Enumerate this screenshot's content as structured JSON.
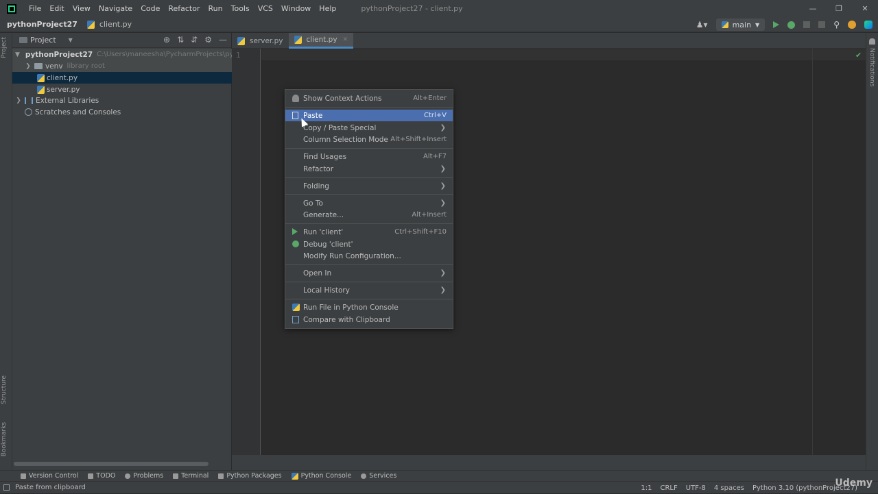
{
  "menubar": {
    "items": [
      "File",
      "Edit",
      "View",
      "Navigate",
      "Code",
      "Refactor",
      "Run",
      "Tools",
      "VCS",
      "Window",
      "Help"
    ],
    "window_title": "pythonProject27 - client.py"
  },
  "navbar": {
    "project": "pythonProject27",
    "file": "client.py",
    "run_config": "main"
  },
  "left_stripe": {
    "project_label": "Project",
    "structure_label": "Structure",
    "bookmarks_label": "Bookmarks"
  },
  "right_stripe": {
    "notifications_label": "Notifications"
  },
  "project_panel": {
    "title": "Project",
    "tree": [
      {
        "label": "pythonProject27",
        "note": "C:\\Users\\maneesha\\PycharmProjects\\pythonP"
      },
      {
        "label": "venv",
        "note": "library root"
      },
      {
        "label": "client.py",
        "note": ""
      },
      {
        "label": "server.py",
        "note": ""
      },
      {
        "label": "External Libraries",
        "note": ""
      },
      {
        "label": "Scratches and Consoles",
        "note": ""
      }
    ]
  },
  "tabs": [
    {
      "label": "server.py",
      "active": false
    },
    {
      "label": "client.py",
      "active": true
    }
  ],
  "editor": {
    "line_number": "1"
  },
  "context_menu": {
    "items": [
      {
        "label": "Show Context Actions",
        "shortcut": "Alt+Enter",
        "icon": "bulb-icon"
      },
      {
        "label": "Paste",
        "shortcut": "Ctrl+V",
        "icon": "clipboard-icon",
        "selected": true
      },
      {
        "label": "Copy / Paste Special",
        "submenu": true
      },
      {
        "label": "Column Selection Mode",
        "shortcut": "Alt+Shift+Insert"
      },
      {
        "label": "Find Usages",
        "shortcut": "Alt+F7"
      },
      {
        "label": "Refactor",
        "submenu": true
      },
      {
        "label": "Folding",
        "submenu": true
      },
      {
        "label": "Go To",
        "submenu": true
      },
      {
        "label": "Generate...",
        "shortcut": "Alt+Insert"
      },
      {
        "label": "Run 'client'",
        "shortcut": "Ctrl+Shift+F10",
        "icon": "run-icon"
      },
      {
        "label": "Debug 'client'",
        "icon": "debug-icon"
      },
      {
        "label": "Modify Run Configuration..."
      },
      {
        "label": "Open In",
        "submenu": true
      },
      {
        "label": "Local History",
        "submenu": true
      },
      {
        "label": "Run File in Python Console",
        "icon": "python-icon"
      },
      {
        "label": "Compare with Clipboard",
        "icon": "compare-icon"
      }
    ]
  },
  "bottom_tools": [
    "Version Control",
    "TODO",
    "Problems",
    "Terminal",
    "Python Packages",
    "Python Console",
    "Services"
  ],
  "status": {
    "message": "Paste from clipboard",
    "position": "1:1",
    "line_sep": "CRLF",
    "encoding": "UTF-8",
    "indent": "4 spaces",
    "interpreter": "Python 3.10 (pythonProject27)"
  },
  "watermark": "Udemy",
  "colors": {
    "selection": "#4b6eaf",
    "run_green": "#59a869",
    "tab_underline": "#4a88c7"
  }
}
